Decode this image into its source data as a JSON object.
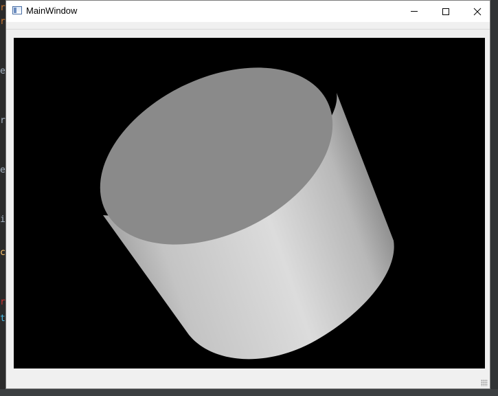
{
  "window": {
    "title": "MainWindow"
  },
  "icons": {
    "app": "application-window-icon",
    "minimize": "minimize-icon",
    "maximize": "maximize-icon",
    "close": "close-icon"
  },
  "viewport": {
    "background_color": "#000000",
    "object": "cylinder",
    "object_cap_color": "#8a8a8a",
    "object_body_color_light": "#dcdcdc",
    "object_body_color_dark": "#808080"
  },
  "colors": {
    "window_bg": "#f0f0f0",
    "titlebar_bg": "#ffffff"
  }
}
